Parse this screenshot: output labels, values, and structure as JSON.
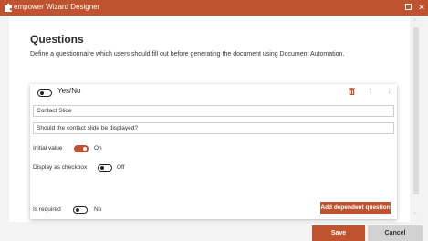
{
  "window": {
    "title": "empower Wizard Designer",
    "icon": "puzzle-icon",
    "maximize_icon": "maximize-icon",
    "close_glyph": "✕"
  },
  "page": {
    "title": "Questions",
    "description": "Define a questionnaire which users should fill out before generating the document using Document Automation."
  },
  "question": {
    "type_label": "Yes/No",
    "type_toggle_state": "off",
    "delete_icon": "trash-icon",
    "move_up_glyph": "↑",
    "move_down_glyph": "↓",
    "title_value": "Contact Slide",
    "question_value": "Should the contact slide be displayed?",
    "initial_value": {
      "label": "Initial value",
      "state": "On"
    },
    "display_checkbox": {
      "label": "Display as checkbox",
      "state": "Off"
    },
    "required": {
      "label": "Is required",
      "state": "No"
    },
    "add_dependent_label": "Add dependent question"
  },
  "scrollbar": {
    "up_glyph": "⌃",
    "down_glyph": "⌄"
  },
  "footer": {
    "save_label": "Save",
    "cancel_label": "Cancel"
  },
  "colors": {
    "accent": "#c0532f",
    "titlebar": "#c0532f",
    "cancel_bg": "#d2d2d2",
    "background": "#f3f3f3"
  }
}
